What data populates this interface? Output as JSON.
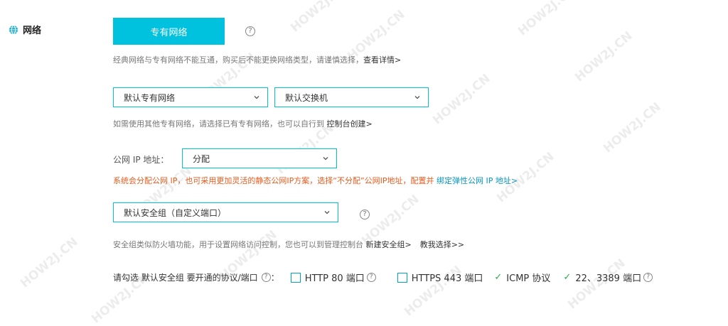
{
  "section": {
    "title": "网络"
  },
  "network_type": {
    "selected_label": "专有网络"
  },
  "network_note": {
    "text": "经典网络与专有网络不能互通，购买后不能更换网络类型，请谨慎选择，",
    "link": "查看详情>"
  },
  "vpc_select": {
    "value": "默认专有网络"
  },
  "switch_select": {
    "value": "默认交换机"
  },
  "vpc_note": {
    "text": "如需使用其他专有网络，请选择已有专有网络，也可以自行到 ",
    "link": "控制台创建>"
  },
  "public_ip": {
    "label": "公网 IP 地址：",
    "value": "分配"
  },
  "public_ip_note": {
    "text": "系统会分配公网 IP，也可采用更加灵活的静态公网IP方案，选择“不分配”公网IP地址，配置并 ",
    "link": "绑定弹性公网 IP 地址>"
  },
  "security_group": {
    "value": "默认安全组（自定义端口）"
  },
  "sg_note": {
    "text": "安全组类似防火墙功能，用于设置网络访问控制，您也可以到管理控制台 ",
    "link1": "新建安全组>",
    "link2": "教我选择>>"
  },
  "protocols": {
    "prefix": "请勾选 默认安全组 要开通的协议/端口",
    "colon": "：",
    "options": [
      {
        "label": "HTTP 80 端口",
        "checked": false
      },
      {
        "label": "HTTPS 443 端口",
        "checked": false
      },
      {
        "label": "ICMP 协议",
        "checked": true
      },
      {
        "label": "22、3389 端口",
        "checked": true
      }
    ]
  },
  "watermark": "HOW2J.CN",
  "colors": {
    "accent": "#00c1de",
    "warning": "#e85b1c",
    "link": "#0a95bf",
    "check": "#2fa84f"
  },
  "icons": {
    "globe": "globe-icon",
    "help": "help-icon",
    "chevron": "chevron-down-icon",
    "check": "check-icon"
  }
}
